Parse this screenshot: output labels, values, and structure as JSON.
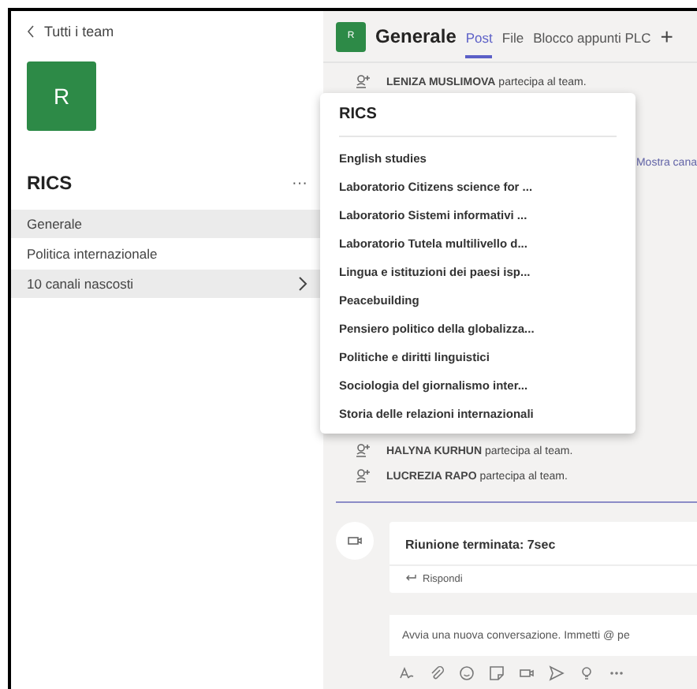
{
  "sidebar": {
    "back_link": "Tutti i team",
    "team_avatar": "R",
    "team_name": "RICS",
    "more": "···",
    "channels": [
      {
        "label": "Generale",
        "selected": true
      },
      {
        "label": "Politica internazionale",
        "selected": false
      }
    ],
    "hidden_channels": {
      "label": "10 canali nascosti",
      "open": true
    }
  },
  "header": {
    "avatar": "R",
    "channel": "Generale",
    "tabs": [
      {
        "label": "Post",
        "selected": true
      },
      {
        "label": "File",
        "selected": false
      },
      {
        "label": "Blocco appunti PLC",
        "selected": false
      }
    ],
    "add": "+"
  },
  "activity": [
    {
      "name": "LENIZA MUSLIMOVA",
      "text": "partecipa al team."
    }
  ],
  "show_channels_link": "Mostra cana",
  "activity_after": [
    {
      "name": "HALYNA KURHUN",
      "text": "partecipa al team."
    },
    {
      "name": "LUCREZIA RAPO",
      "text": "partecipa al team."
    }
  ],
  "meeting": {
    "title": "Riunione terminata: 7sec",
    "reply": "Rispondi"
  },
  "compose": {
    "placeholder": "Avvia una nuova conversazione. Immetti @ pe"
  },
  "popup": {
    "title": "RICS",
    "items": [
      "English studies",
      "Laboratorio Citizens science for ...",
      "Laboratorio Sistemi informativi ...",
      "Laboratorio Tutela multilivello d...",
      "Lingua e istituzioni dei paesi isp...",
      "Peacebuilding",
      "Pensiero politico della globalizza...",
      "Politiche e diritti linguistici",
      "Sociologia del giornalismo inter...",
      "Storia delle relazioni internazionali"
    ]
  }
}
